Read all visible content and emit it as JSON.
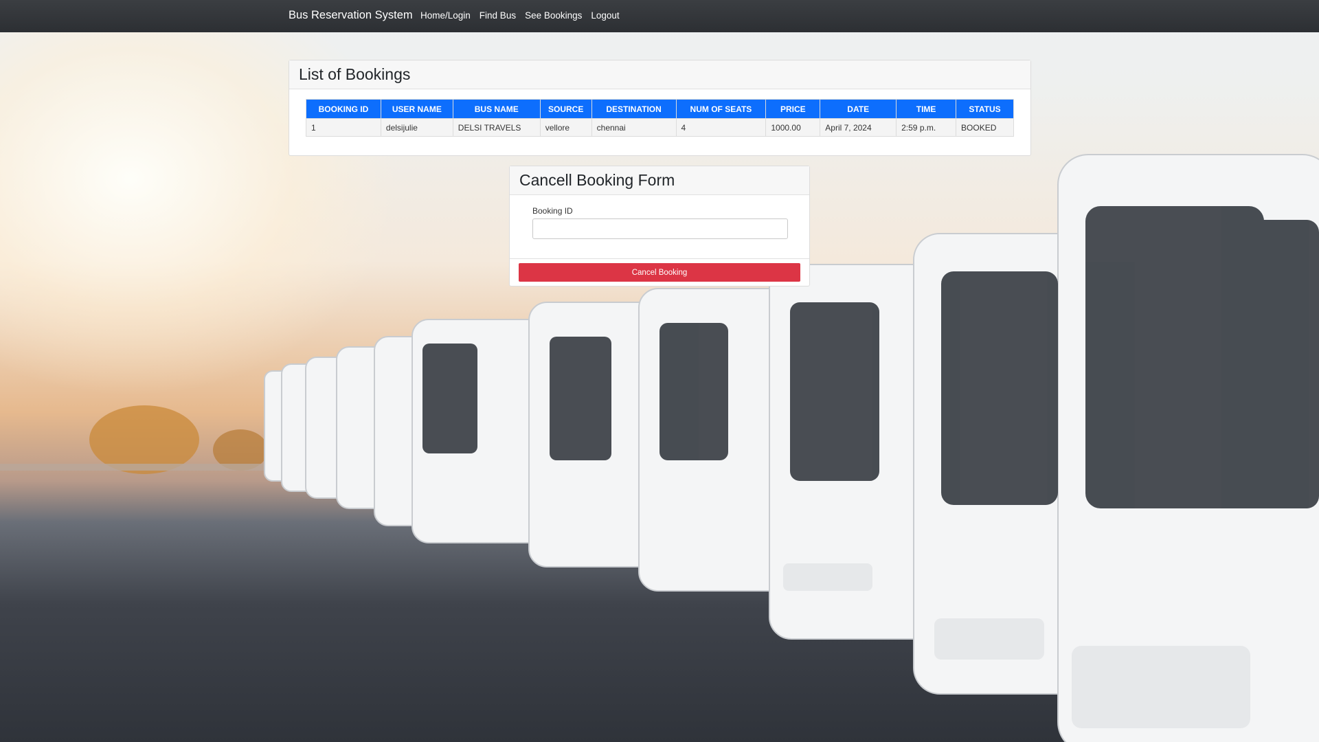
{
  "navbar": {
    "brand": "Bus Reservation System",
    "links": [
      "Home/Login",
      "Find Bus",
      "See Bookings",
      "Logout"
    ]
  },
  "bookings": {
    "title": "List of Bookings",
    "columns": [
      "BOOKING ID",
      "USER NAME",
      "BUS NAME",
      "SOURCE",
      "DESTINATION",
      "NUM OF SEATS",
      "PRICE",
      "DATE",
      "TIME",
      "STATUS"
    ],
    "rows": [
      [
        "1",
        "delsijulie",
        "DELSI TRAVELS",
        "vellore",
        "chennai",
        "4",
        "1000.00",
        "April 7, 2024",
        "2:59 p.m.",
        "BOOKED"
      ]
    ]
  },
  "cancel_form": {
    "title": "Cancell Booking Form",
    "booking_id_label": "Booking ID",
    "booking_id_value": "",
    "submit_label": "Cancel Booking"
  },
  "colors": {
    "navbar": "#2c2f33",
    "table_header": "#0d6efd",
    "cancel_button": "#dc3545"
  }
}
